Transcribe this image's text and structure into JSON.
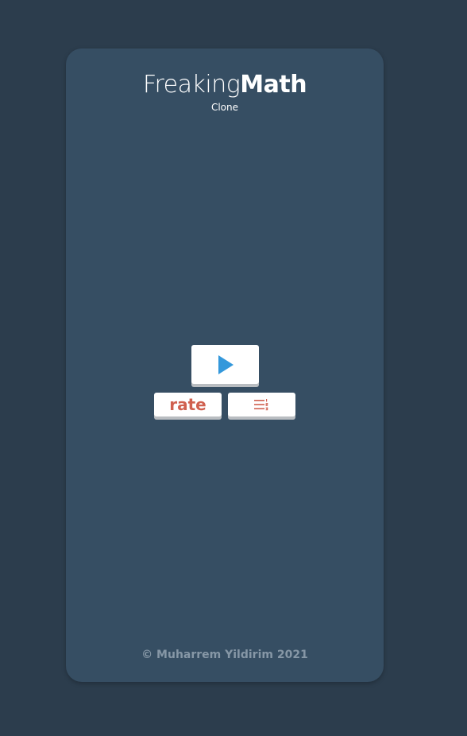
{
  "app": {
    "title_light": "Freaking",
    "title_bold": "Math",
    "subtitle": "Clone"
  },
  "buttons": {
    "play_icon": "play-icon",
    "rate_label": "rate",
    "leaderboard_icon": "leaderboard-icon"
  },
  "footer": {
    "text": "© Muharrem Yildirim 2021"
  },
  "colors": {
    "background": "#2c3d4d",
    "card": "#364e63",
    "play_accent": "#3498db",
    "rate_accent": "#d0604f"
  }
}
